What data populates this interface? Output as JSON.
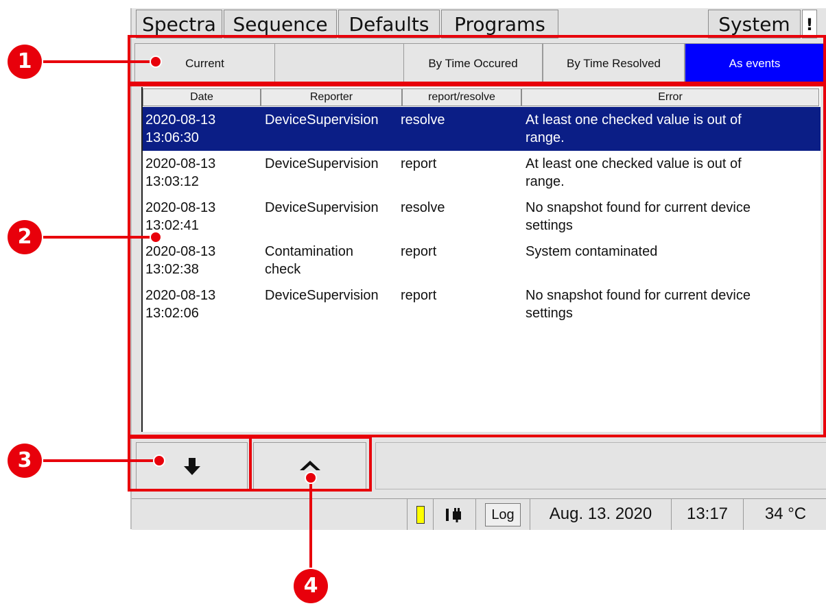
{
  "tabs": {
    "spectra": "Spectra",
    "sequence": "Sequence",
    "defaults": "Defaults",
    "programs": "Programs",
    "system": "System",
    "alert": "!"
  },
  "filters": {
    "current": "Current",
    "by_time_occured": "By Time Occured",
    "by_time_resolved": "By Time Resolved",
    "as_events": "As events",
    "active_color": "#0000ff"
  },
  "table": {
    "headers": [
      "Date",
      "Reporter",
      "report/resolve",
      "Error"
    ],
    "rows": [
      {
        "date1": "2020-08-13",
        "date2": "13:06:30",
        "reporter1": "DeviceSupervision",
        "reporter2": "",
        "action": "resolve",
        "error1": "At least one checked value is out of",
        "error2": "range."
      },
      {
        "date1": "2020-08-13",
        "date2": "13:03:12",
        "reporter1": "DeviceSupervision",
        "reporter2": "",
        "action": "report",
        "error1": "At least one checked value is out of",
        "error2": "range."
      },
      {
        "date1": "2020-08-13",
        "date2": "13:02:41",
        "reporter1": "DeviceSupervision",
        "reporter2": "",
        "action": "resolve",
        "error1": "No snapshot found for current device",
        "error2": "settings"
      },
      {
        "date1": "2020-08-13",
        "date2": "13:02:38",
        "reporter1": "Contamination",
        "reporter2": "check",
        "action": "report",
        "error1": "System contaminated",
        "error2": ""
      },
      {
        "date1": "2020-08-13",
        "date2": "13:02:06",
        "reporter1": "DeviceSupervision",
        "reporter2": "",
        "action": "report",
        "error1": "No snapshot found for current device",
        "error2": "settings"
      }
    ],
    "selected_color": "#0b1e86"
  },
  "nav": {
    "down_icon": "arrow-down-icon",
    "up_icon": "chevron-up-icon"
  },
  "status": {
    "log": "Log",
    "date": "Aug. 13. 2020",
    "time": "13:17",
    "temperature": "34 °C",
    "indicator_color": "#ffff00",
    "plug_icon": "plug-icon"
  },
  "callouts": [
    "1",
    "2",
    "3",
    "4"
  ],
  "highlight_color": "#e8000b"
}
